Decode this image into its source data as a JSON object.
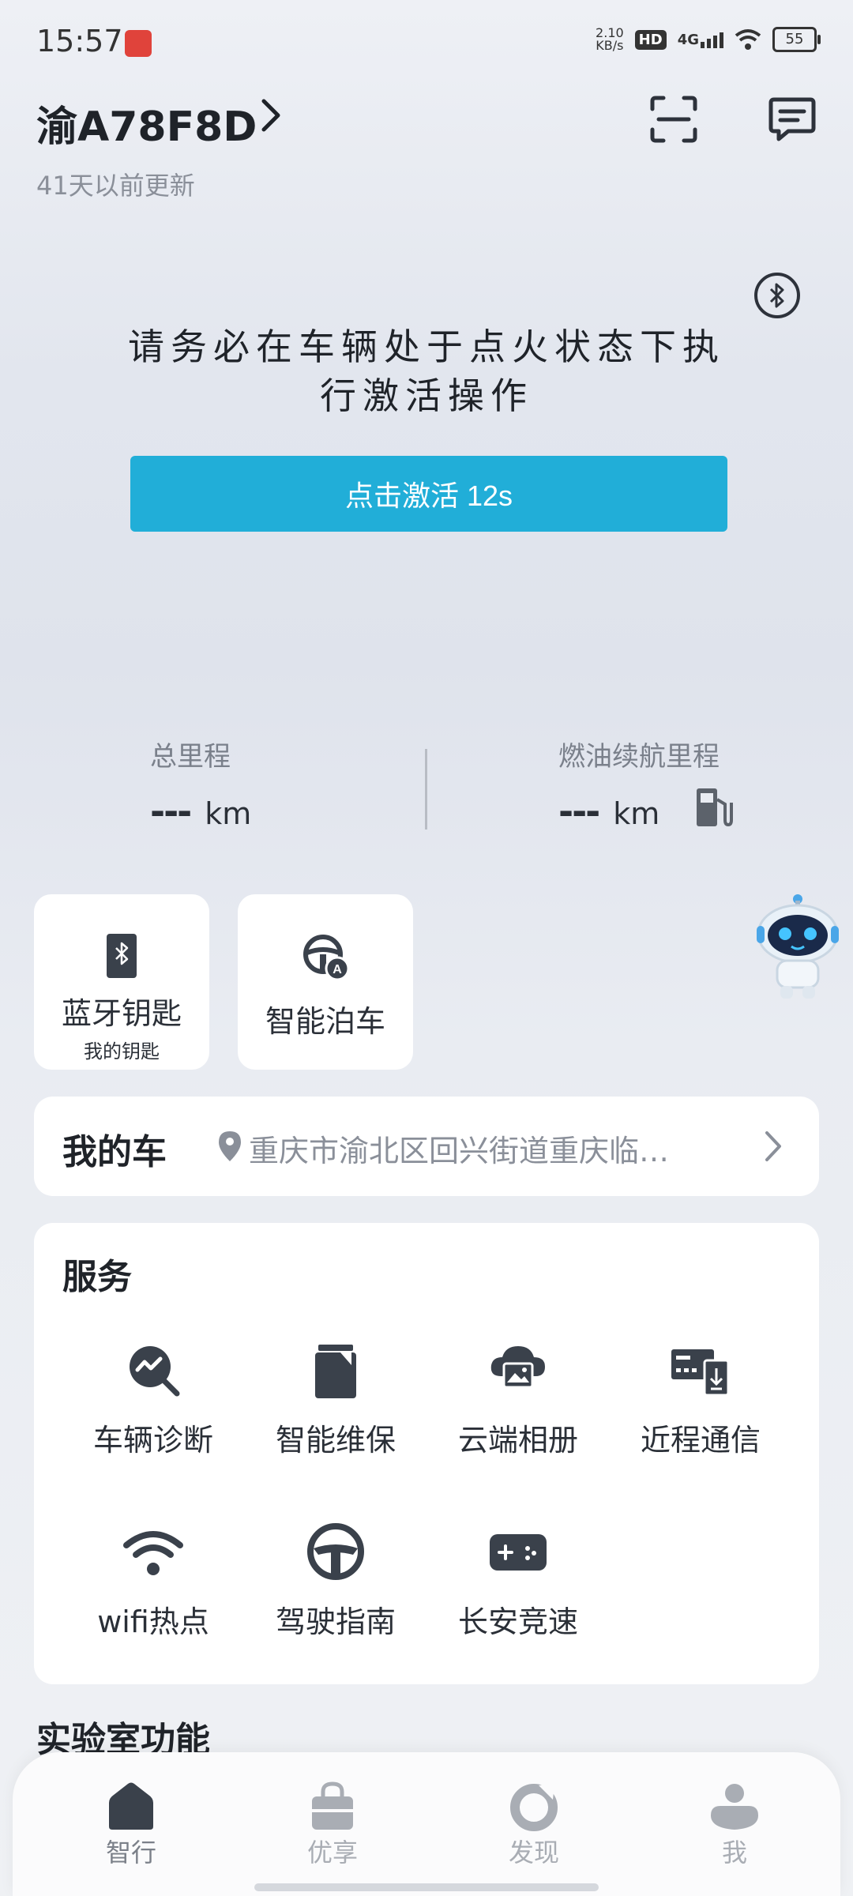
{
  "status_bar": {
    "time": "15:57",
    "net_speed_value": "2.10",
    "net_speed_unit": "KB/s",
    "hd": "HD",
    "network": "4G",
    "battery": "55"
  },
  "header": {
    "plate": "渝A78F8D",
    "updated": "41天以前更新"
  },
  "warning": {
    "text": "请务必在车辆处于点火状态下执行激活操作"
  },
  "activate_button": {
    "label": "点击激活 12s"
  },
  "mileage": {
    "total_label": "总里程",
    "total_value": "---",
    "total_unit": "km",
    "range_label": "燃油续航里程",
    "range_value": "---",
    "range_unit": "km"
  },
  "quick": {
    "bt_key_label": "蓝牙钥匙",
    "bt_key_sub": "我的钥匙",
    "parking_label": "智能泊车"
  },
  "my_car": {
    "title": "我的车",
    "address": "重庆市渝北区回兴街道重庆临…"
  },
  "services": {
    "title": "服务",
    "items": [
      {
        "label": "车辆诊断",
        "icon": "diagnosis-icon"
      },
      {
        "label": "智能维保",
        "icon": "maintenance-icon"
      },
      {
        "label": "云端相册",
        "icon": "cloud-album-icon"
      },
      {
        "label": "近程通信",
        "icon": "near-field-icon"
      },
      {
        "label": "wifi热点",
        "icon": "wifi-icon"
      },
      {
        "label": "驾驶指南",
        "icon": "steering-wheel-icon"
      },
      {
        "label": "长安竞速",
        "icon": "gamepad-icon"
      }
    ]
  },
  "lab": {
    "title": "实验室功能"
  },
  "nav": {
    "items": [
      {
        "label": "智行",
        "icon": "home-icon"
      },
      {
        "label": "优享",
        "icon": "bag-icon"
      },
      {
        "label": "发现",
        "icon": "discover-icon"
      },
      {
        "label": "我",
        "icon": "profile-icon"
      }
    ]
  },
  "colors": {
    "accent": "#21aed8",
    "icon_dark": "#3a414b",
    "nav_inactive": "#a9adb4"
  }
}
